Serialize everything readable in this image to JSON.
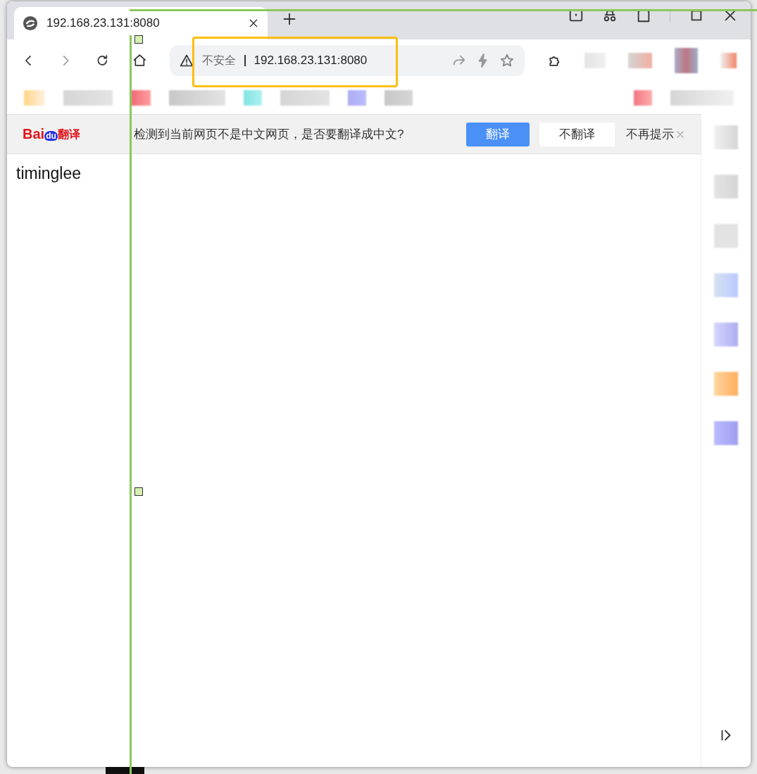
{
  "tab": {
    "title": "192.168.23.131:8080",
    "selected": true
  },
  "address_bar": {
    "security_label": "不安全",
    "url": "192.168.23.131:8080"
  },
  "translate_bar": {
    "logo": [
      "Bai",
      "du",
      "翻译"
    ],
    "message": "检测到当前网页不是中文网页，是否要翻译成中文?",
    "buttons": [
      {
        "label": "翻译",
        "kind": "primary"
      },
      {
        "label": "不翻译",
        "kind": "secondary"
      },
      {
        "label": "不再提示",
        "kind": "link"
      }
    ]
  },
  "page": {
    "text": "timinglee"
  }
}
